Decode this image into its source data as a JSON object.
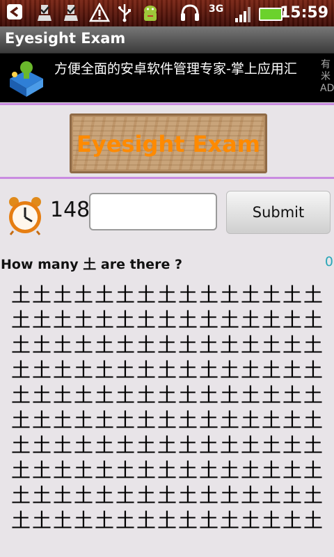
{
  "status_bar": {
    "time": "15:59",
    "network_label": "3G",
    "icons": [
      "back-icon",
      "download-icon",
      "download-icon",
      "warning-icon",
      "usb-icon",
      "android-icon",
      "headset-icon",
      "network-3g-icon",
      "signal-icon",
      "battery-charging-icon"
    ]
  },
  "app": {
    "title": "Eyesight Exam"
  },
  "ad": {
    "text": "方便全面的安卓软件管理专家-掌上应用汇",
    "brand": "有米AD"
  },
  "logo": {
    "text": "Eyesight Exam",
    "text_color": "#ff8a00"
  },
  "controls": {
    "timer_value": "148",
    "answer_value": "",
    "submit_label": "Submit"
  },
  "quiz": {
    "question": "How many 土 are there ?",
    "score": "0",
    "grid_rows": [
      "土土土土土土土土土土土土土土土",
      "土土土土土土土土土土土土土土土",
      "土土土土土土土土土土土土土土土",
      "土土土土土土土土土土土土土土土",
      "土土土土土土土土土土土土土土土",
      "土土土土土土土土土土土土土土土",
      "土土土土土土土土土土土土土土土",
      "土土土土土土土土土土土土土土土",
      "土土土土土土土土土土土土土土土",
      "土土土土土土土土土土土土土土土"
    ]
  },
  "colors": {
    "accent_divider": "#c98be0",
    "score_color": "#2aa7b8"
  }
}
